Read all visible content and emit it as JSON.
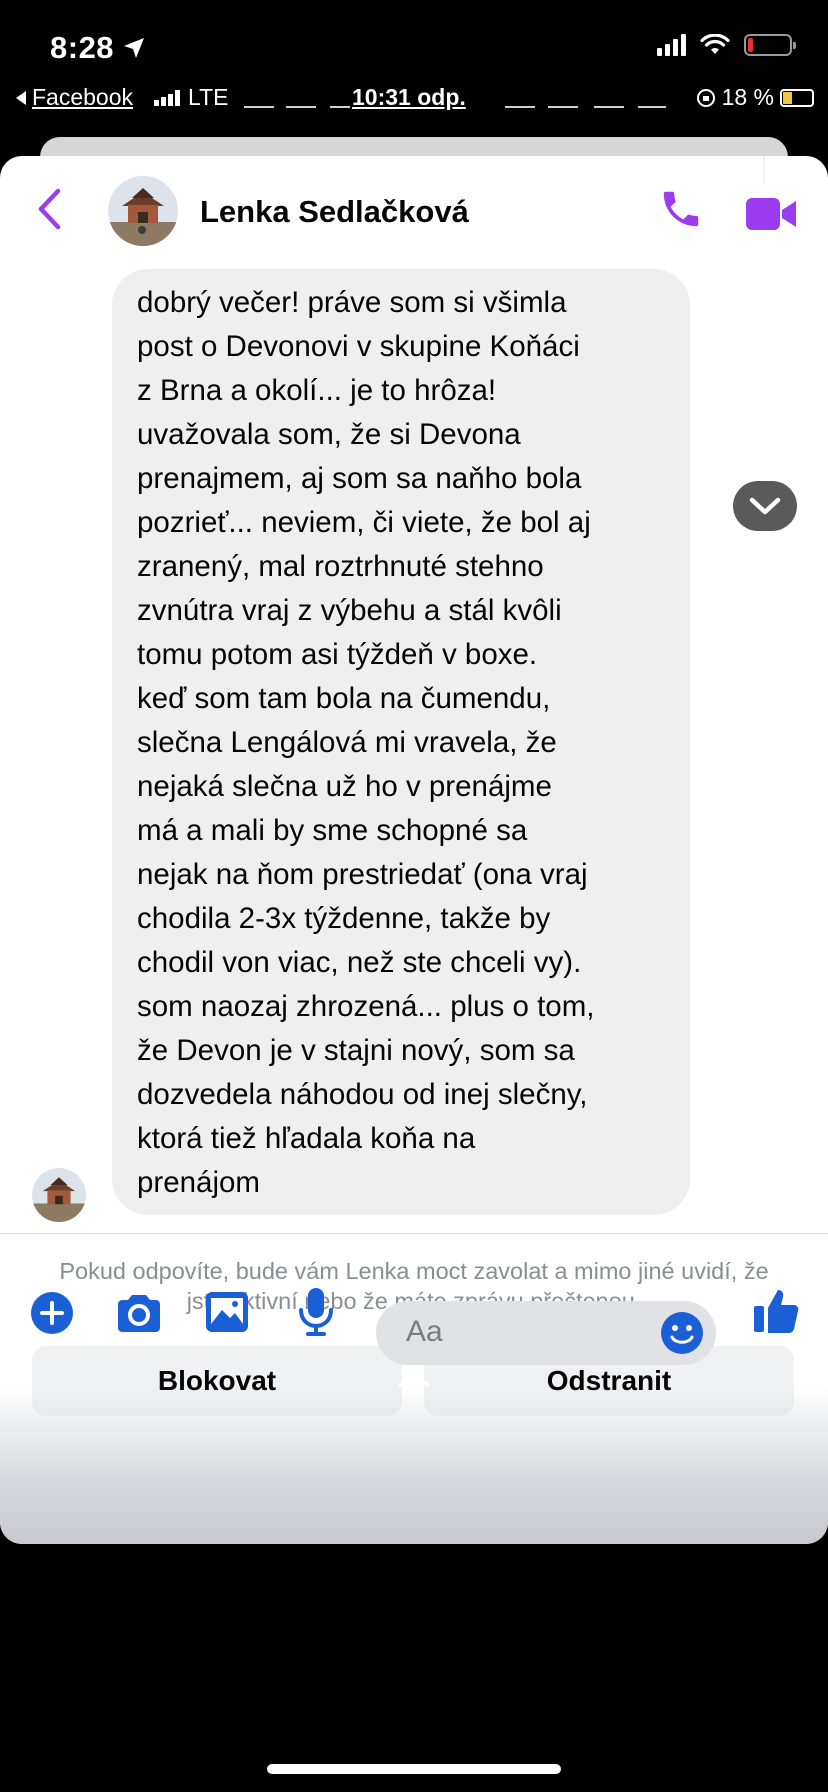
{
  "status_bar": {
    "time": "8:28"
  },
  "inner_status": {
    "back_app": "Facebook",
    "network": "LTE",
    "time": "10:31 odp.",
    "battery": "18 %"
  },
  "chat": {
    "contact_name": "Lenka Sedlačková",
    "accent_color": "#a033ff",
    "message": "dobrý večer! práve som si všimla\npost o Devonovi v skupine Koňáci\nz Brna a okolí... je to hrôza!\nuvažovala som, že si Devona\nprenajmem, aj som sa naňho bola\npozrieť... neviem, či viete, že bol aj\nzranený, mal roztrhnuté stehno\nzvnútra vraj z výbehu a stál kvôli\ntomu potom asi týždeň v boxe.\nkeď som tam bola na čumendu,\nslečna Lengálová mi vravela, že\nnejaká slečna už ho v prenájme\nmá a mali by sme schopné sa\nnejak na ňom prestriedať (ona vraj\nchodila 2-3x týždenne, takže by\nchodil von viac, než ste chceli vy).\nsom naozaj zhrozená... plus o tom,\nže Devon je v stajni nový, som sa\ndozvedela náhodou od inej slečny,\nktorá tiež hľadala koňa na\nprenájom"
  },
  "request": {
    "notice": "Pokud odpovíte, bude vám Lenka moct zavolat a mimo jiné uvidí, že jste aktivní nebo že máte zprávu přečtenou.",
    "block_label": "Blokovat",
    "remove_label": "Odstranit"
  },
  "composer": {
    "placeholder": "Aa",
    "icon_color": "#1b5fd6"
  }
}
